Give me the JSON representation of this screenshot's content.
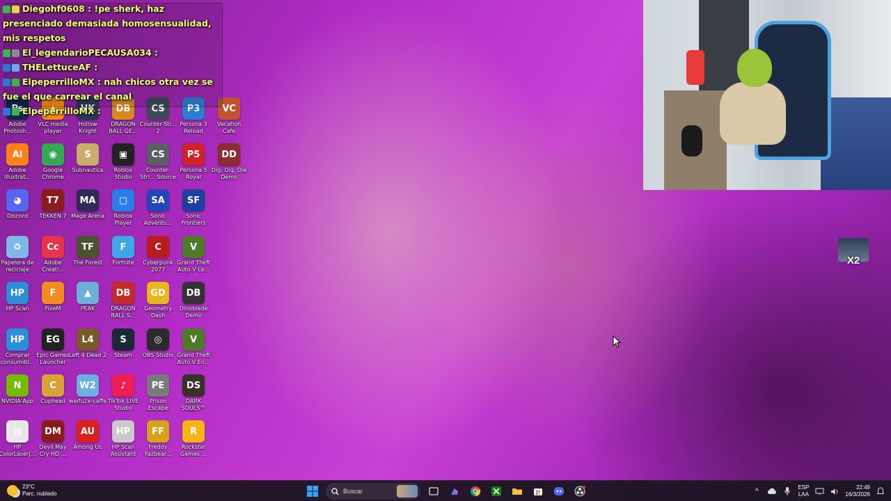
{
  "chat": {
    "messages": [
      {
        "user": "Diegohf0608",
        "text": " : !pe sherk, haz presenciado demasiada homosensualidad, mis respetos"
      },
      {
        "user": "El_legendarioPECAUSA034",
        "text": " :"
      },
      {
        "user": "THELettuceAF",
        "text": " :"
      },
      {
        "user": "ElpeperrilloMX",
        "text": " : nah chicos otra vez se fue el que carrear el canal"
      },
      {
        "user": "ElpeperrilloMX",
        "text": " :"
      }
    ]
  },
  "desktop": {
    "icons": [
      {
        "label": "Adobe Photosh...",
        "glyph": "Ps",
        "color": "#0e2a4a"
      },
      {
        "label": "VLC media player",
        "glyph": "▲",
        "color": "#f08a16"
      },
      {
        "label": "Hollow Knight",
        "glyph": "HK",
        "color": "#2b3a52"
      },
      {
        "label": "DRAGON BALL GE...",
        "glyph": "DB",
        "color": "#d98a1e"
      },
      {
        "label": "Counter-Str... 2",
        "glyph": "CS",
        "color": "#3e4a5a"
      },
      {
        "label": "Persona 3 Reload",
        "glyph": "P3",
        "color": "#2a7fd0"
      },
      {
        "label": "Vacation Cafe Simulator D...",
        "glyph": "VC",
        "color": "#c0542e"
      },
      {
        "label": "Adobe Illustrat...",
        "glyph": "Ai",
        "color": "#ff7f18"
      },
      {
        "label": "Google Chrome",
        "glyph": "◉",
        "color": "#34a853"
      },
      {
        "label": "Subnautica",
        "glyph": "S",
        "color": "#c9ad6a"
      },
      {
        "label": "Roblox Studio",
        "glyph": "▣",
        "color": "#222222"
      },
      {
        "label": "Counter-Stri... Source",
        "glyph": "CS",
        "color": "#5a5f66"
      },
      {
        "label": "Persona 5 Royal",
        "glyph": "P5",
        "color": "#d0202a"
      },
      {
        "label": "Dig, Dig, Die Demo",
        "glyph": "DD",
        "color": "#8a2f2f"
      },
      {
        "label": "Discord",
        "glyph": "◕",
        "color": "#5865f2"
      },
      {
        "label": "TEKKEN 7",
        "glyph": "T7",
        "color": "#8b1c1c"
      },
      {
        "label": "Mage Arena",
        "glyph": "MA",
        "color": "#2f2a5a"
      },
      {
        "label": "Roblox Player",
        "glyph": "▢",
        "color": "#2b7de9"
      },
      {
        "label": "Sonic Adventu...",
        "glyph": "SA",
        "color": "#2447b8"
      },
      {
        "label": "Sonic Frontiers",
        "glyph": "SF",
        "color": "#1d3f9e"
      },
      {
        "label": "Papelera de reciclaje",
        "glyph": "♻",
        "color": "#7fb8e8"
      },
      {
        "label": "Adobe Creati...",
        "glyph": "Cc",
        "color": "#e8344a"
      },
      {
        "label": "The Forest",
        "glyph": "TF",
        "color": "#4b5230"
      },
      {
        "label": "Fortnite",
        "glyph": "F",
        "color": "#3ea7e8"
      },
      {
        "label": "Cyberpunk 2077",
        "glyph": "C",
        "color": "#b81c1c"
      },
      {
        "label": "Grand Theft Auto V Le...",
        "glyph": "V",
        "color": "#4f7a2a"
      },
      {
        "label": "HP Scan",
        "glyph": "HP",
        "color": "#2a8fd8"
      },
      {
        "label": "FiveM",
        "glyph": "F",
        "color": "#f28c1f"
      },
      {
        "label": "PEAK",
        "glyph": "▲",
        "color": "#6ab0d8"
      },
      {
        "label": "DRAGON BALL S...",
        "glyph": "DB",
        "color": "#c42a2a"
      },
      {
        "label": "Geometry Dash",
        "glyph": "GD",
        "color": "#e8b71c"
      },
      {
        "label": "Dinoblade Demo",
        "glyph": "DB",
        "color": "#333333"
      },
      {
        "label": "Comprar consumibl...",
        "glyph": "HP",
        "color": "#2a8fd8"
      },
      {
        "label": "Epic Games Launcher",
        "glyph": "EG",
        "color": "#222222"
      },
      {
        "label": "Left 4 Dead 2",
        "glyph": "L4",
        "color": "#7a5a2a"
      },
      {
        "label": "Steam",
        "glyph": "S",
        "color": "#1b2838"
      },
      {
        "label": "OBS Studio",
        "glyph": "◎",
        "color": "#2b2b2b"
      },
      {
        "label": "Grand Theft Auto V En...",
        "glyph": "V",
        "color": "#4f7a2a"
      },
      {
        "label": "NVIDIA App",
        "glyph": "N",
        "color": "#76b900"
      },
      {
        "label": "Cuphead",
        "glyph": "C",
        "color": "#d8a43a"
      },
      {
        "label": "waifu2x-caffe",
        "glyph": "W2",
        "color": "#6ab0e0"
      },
      {
        "label": "TikTok LIVE Studio",
        "glyph": "♪",
        "color": "#ee1d52"
      },
      {
        "label": "Prison Escape Simulator D...",
        "glyph": "PE",
        "color": "#7a7a7a"
      },
      {
        "label": "DARK SOULS™ RE...",
        "glyph": "DS",
        "color": "#3a3228"
      },
      {
        "label": "HP ColorLaserJ...",
        "glyph": "▤",
        "color": "#e8e8e8"
      },
      {
        "label": "Devil May Cry HD ...",
        "glyph": "DM",
        "color": "#8a1c1c"
      },
      {
        "label": "Among Us",
        "glyph": "AU",
        "color": "#d8201c"
      },
      {
        "label": "HP Scan Assistant",
        "glyph": "HP",
        "color": "#c9c9c9"
      },
      {
        "label": "Freddy Fazbear...",
        "glyph": "FF",
        "color": "#d6a21c"
      },
      {
        "label": "Rockstar Games ...",
        "glyph": "R",
        "color": "#f7b614"
      }
    ]
  },
  "avatar": {
    "tag": "X2"
  },
  "taskbar": {
    "weather_temp": "23°C",
    "weather_desc": "Parc. nublado",
    "search_placeholder": "Buscar",
    "lang_top": "ESP",
    "lang_bottom": "LAA",
    "time": "22:49",
    "date": "16/3/2026"
  }
}
